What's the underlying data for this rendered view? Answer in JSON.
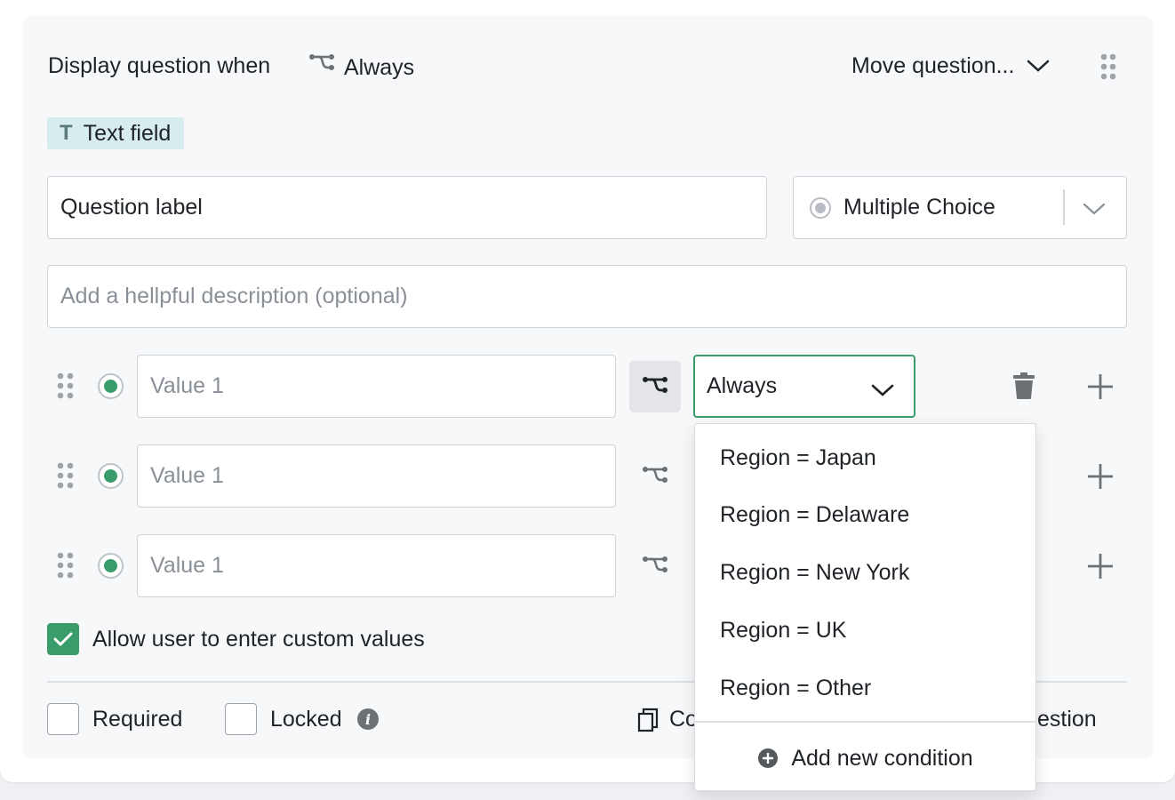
{
  "header": {
    "display_label": "Display question when",
    "display_condition": "Always",
    "move_label": "Move question..."
  },
  "question": {
    "type_chip": "Text field",
    "type_chip_icon": "T",
    "label_value": "Question label",
    "type_select": "Multiple Choice",
    "description_placeholder": "Add a hellpful description (optional)"
  },
  "options": [
    {
      "placeholder": "Value 1",
      "condition": "Always"
    },
    {
      "placeholder": "Value 1"
    },
    {
      "placeholder": "Value 1"
    }
  ],
  "custom_values_label": "Allow user to enter custom values",
  "footer": {
    "required_label": "Required",
    "locked_label": "Locked",
    "copy_partial": "Co",
    "delete_partial": "estion"
  },
  "condition_menu": {
    "items": [
      "Region = Japan",
      "Region = Delaware",
      "Region = New York",
      "Region = UK",
      "Region = Other"
    ],
    "add_label": "Add new condition"
  },
  "colors": {
    "accent": "#3a9c6b",
    "chip_bg": "#d7ecec",
    "card_bg": "#f7f8fa"
  }
}
